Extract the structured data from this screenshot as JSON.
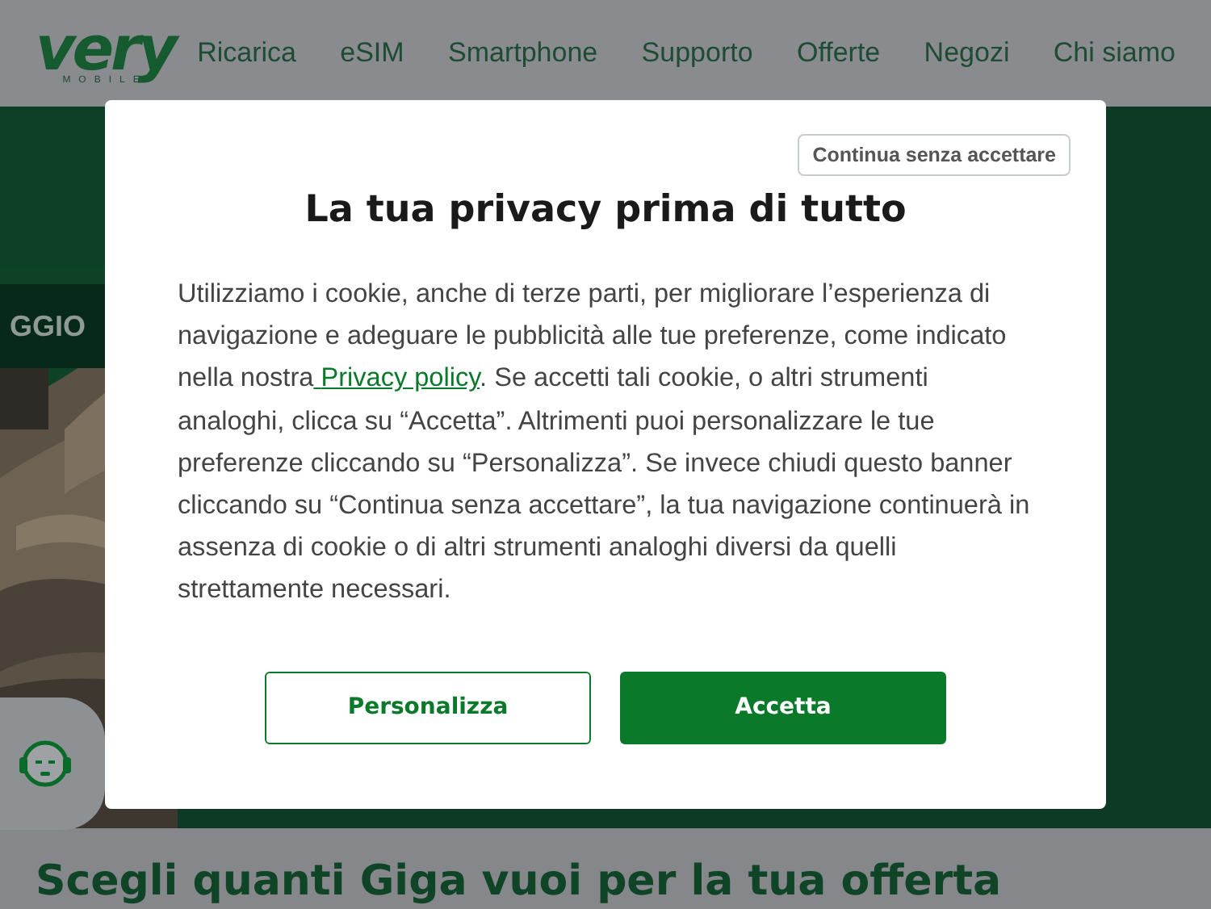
{
  "header": {
    "logo": {
      "word": "very",
      "sub": "MOBILE"
    },
    "nav": [
      {
        "label": "Ricarica"
      },
      {
        "label": "eSIM"
      },
      {
        "label": "Smartphone"
      },
      {
        "label": "Supporto"
      },
      {
        "label": "Offerte"
      },
      {
        "label": "Negozi"
      },
      {
        "label": "Chi siamo"
      }
    ]
  },
  "hero": {
    "badge": "GGIO"
  },
  "section_title": "Scegli quanti Giga vuoi per la tua offerta",
  "cookie_dialog": {
    "skip_button": "Continua senza accettare",
    "title": "La tua privacy prima di tutto",
    "text_before": "Utilizziamo i cookie, anche di terze parti, per migliorare l’esperienza di navigazione e adeguare le pubblicità alle tue preferenze, come indicato nella nostra",
    "link": "Privacy policy",
    "text_after": ". Se accetti tali cookie, o altri strumenti analoghi, clicca su “Accetta”. Altrimenti puoi personalizzare le tue preferenze cliccando su “Personalizza”. Se invece chiudi questo banner cliccando su “Continua senza accettare”, la tua navigazione continuerà in assenza di cookie o di altri strumenti analoghi diversi da quelli strettamente necessari.",
    "buttons": [
      {
        "label": "Personalizza",
        "kind": "secondary"
      },
      {
        "label": "Accetta",
        "kind": "primary"
      }
    ]
  }
}
